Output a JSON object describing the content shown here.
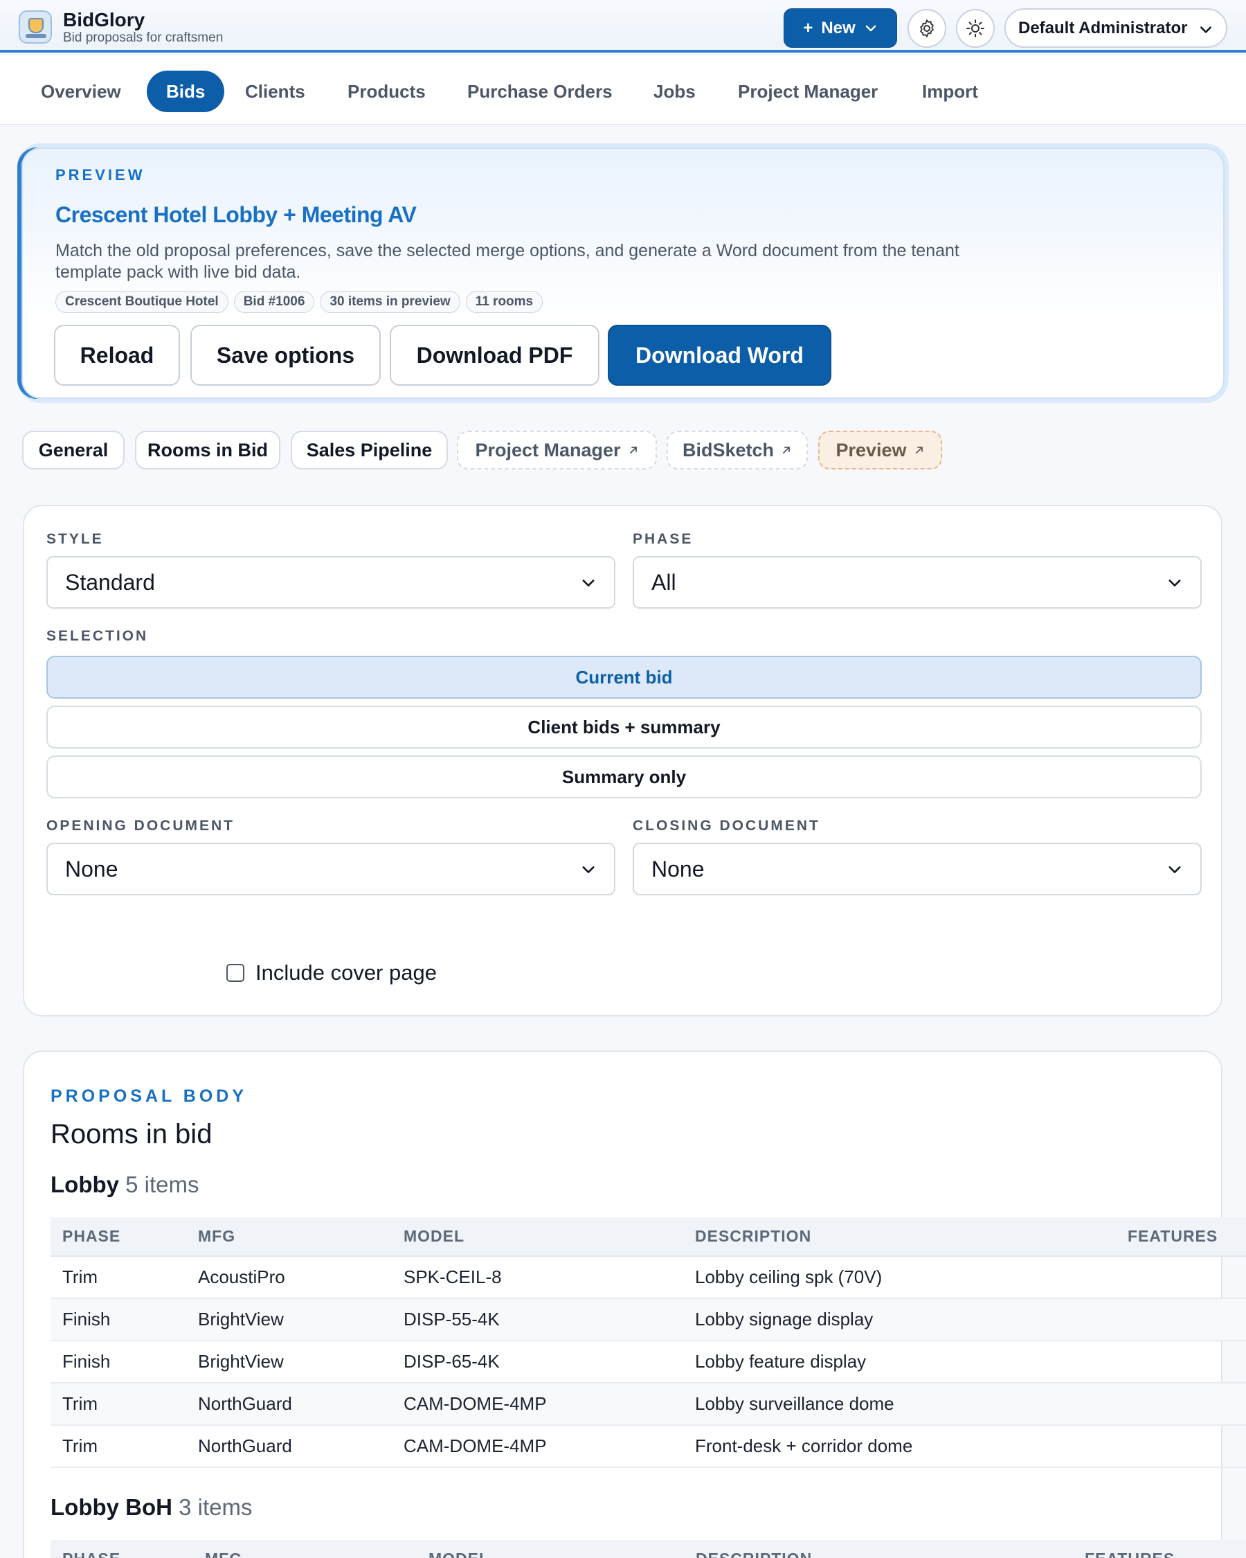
{
  "app": {
    "name": "BidGlory",
    "tagline": "Bid proposals for craftsmen",
    "new_label": "New",
    "user": "Default Administrator"
  },
  "nav": [
    "Overview",
    "Bids",
    "Clients",
    "Products",
    "Purchase Orders",
    "Jobs",
    "Project Manager",
    "Import"
  ],
  "nav_active": "Bids",
  "preview": {
    "eyebrow": "PREVIEW",
    "title": "Crescent Hotel Lobby + Meeting AV",
    "description": "Match the old proposal preferences, save the selected merge options, and generate a Word document from the tenant template pack with live bid data.",
    "chips": [
      "Crescent Boutique Hotel",
      "Bid #1006",
      "30 items in preview",
      "11 rooms"
    ],
    "buttons": {
      "reload": "Reload",
      "save": "Save options",
      "pdf": "Download PDF",
      "word": "Download Word"
    }
  },
  "tabs": {
    "general": "General",
    "rooms": "Rooms in Bid",
    "pipeline": "Sales Pipeline",
    "pm": "Project Manager",
    "sketch": "BidSketch",
    "preview": "Preview"
  },
  "options": {
    "style_label": "STYLE",
    "style_value": "Standard",
    "phase_label": "PHASE",
    "phase_value": "All",
    "selection_label": "SELECTION",
    "selection": [
      "Current bid",
      "Client bids + summary",
      "Summary only"
    ],
    "selection_active": "Current bid",
    "opening_label": "OPENING DOCUMENT",
    "opening_value": "None",
    "closing_label": "CLOSING DOCUMENT",
    "closing_value": "None",
    "cover_label": "Include cover page"
  },
  "body": {
    "eyebrow": "PROPOSAL BODY",
    "heading": "Rooms in bid",
    "columns": [
      "PHASE",
      "MFG",
      "MODEL",
      "DESCRIPTION",
      "FEATURES"
    ],
    "rooms": [
      {
        "name": "Lobby",
        "count": "5 items",
        "rows": [
          [
            "Trim",
            "AcoustiPro",
            "SPK-CEIL-8",
            "Lobby ceiling spk (70V)",
            ""
          ],
          [
            "Finish",
            "BrightView",
            "DISP-55-4K",
            "Lobby signage display",
            ""
          ],
          [
            "Finish",
            "BrightView",
            "DISP-65-4K",
            "Lobby feature display",
            ""
          ],
          [
            "Trim",
            "NorthGuard",
            "CAM-DOME-4MP",
            "Lobby surveillance dome",
            ""
          ],
          [
            "Trim",
            "NorthGuard",
            "CAM-DOME-4MP",
            "Front-desk + corridor dome",
            ""
          ]
        ]
      },
      {
        "name": "Lobby BoH",
        "count": "3 items",
        "rows": []
      }
    ]
  },
  "colors": {
    "primary": "#0c5ea8",
    "accent": "#1870c4"
  }
}
